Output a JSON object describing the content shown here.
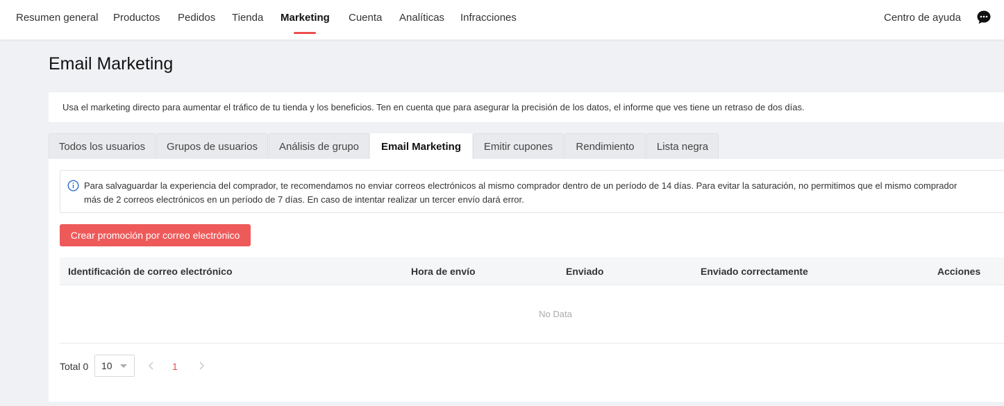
{
  "nav": {
    "items": [
      {
        "label": "Resumen general"
      },
      {
        "label": "Productos"
      },
      {
        "label": "Pedidos"
      },
      {
        "label": "Tienda"
      },
      {
        "label": "Marketing",
        "active": true
      },
      {
        "label": "Cuenta"
      },
      {
        "label": "Analíticas"
      },
      {
        "label": "Infracciones"
      }
    ],
    "help": "Centro de ayuda",
    "chat_icon": "chat-bubble-icon"
  },
  "page": {
    "title": "Email Marketing",
    "notice": "Usa el marketing directo para aumentar el tráfico de tu tienda y los beneficios. Ten en cuenta que para asegurar la precisión de los datos, el informe que ves tiene un retraso de dos días."
  },
  "tabs": [
    {
      "label": "Todos los usuarios"
    },
    {
      "label": "Grupos de usuarios"
    },
    {
      "label": "Análisis de grupo"
    },
    {
      "label": "Email Marketing",
      "active": true
    },
    {
      "label": "Emitir cupones"
    },
    {
      "label": "Rendimiento"
    },
    {
      "label": "Lista negra"
    }
  ],
  "info": {
    "line1": "Para salvaguardar la experiencia del comprador, te recomendamos no enviar correos electrónicos al mismo comprador dentro de un período de 14 días. Para evitar la saturación, no permitimos que el mismo comprador",
    "line2": "más de 2 correos electrónicos en un período de 7 días. En caso de intentar realizar un tercer envío dará error."
  },
  "create_button": "Crear promoción por correo electrónico",
  "table": {
    "columns": [
      "Identificación de correo electrónico",
      "Hora de envío",
      "Enviado",
      "Enviado correctamente",
      "Acciones"
    ],
    "empty_text": "No Data"
  },
  "pagination": {
    "total": "Total 0",
    "page_size": "10",
    "current_page": "1"
  },
  "colors": {
    "accent": "#ee4d4d",
    "button": "#ee5a5a"
  }
}
